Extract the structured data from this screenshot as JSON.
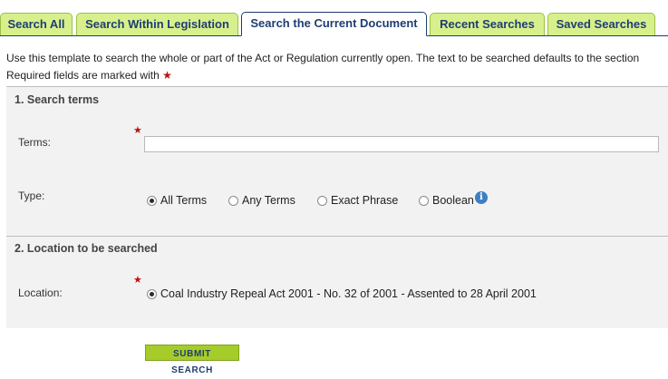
{
  "tabs": [
    {
      "label": "Search All",
      "active": false
    },
    {
      "label": "Search Within Legislation",
      "active": false
    },
    {
      "label": "Search the Current Document",
      "active": true
    },
    {
      "label": "Recent Searches",
      "active": false
    },
    {
      "label": "Saved Searches",
      "active": false
    }
  ],
  "intro": {
    "line1": "Use this template to search the whole or part of the Act or Regulation currently open. The text to be searched defaults to the section",
    "line2": "Required fields are marked with",
    "required_marker": "★"
  },
  "search_terms": {
    "title": "1. Search terms",
    "terms_label": "Terms:",
    "terms_value": "",
    "required_marker": "★",
    "type_label": "Type:",
    "type_options": [
      {
        "label": "All Terms",
        "checked": true
      },
      {
        "label": "Any Terms",
        "checked": false
      },
      {
        "label": "Exact Phrase",
        "checked": false
      },
      {
        "label": "Boolean",
        "checked": false
      }
    ],
    "info_icon": "i"
  },
  "location": {
    "title": "2. Location to be searched",
    "label": "Location:",
    "required_marker": "★",
    "option": {
      "label": "Coal Industry Repeal Act 2001 - No. 32 of 2001 - Assented to 28 April 2001",
      "checked": true
    }
  },
  "submit_label": "SUBMIT SEARCH",
  "colors": {
    "tab_bg": "#d8f08c",
    "tab_text": "#1e3e72",
    "panel_bg": "#f2f2f2",
    "required": "#c01010",
    "submit_bg": "#a6cc2a"
  }
}
